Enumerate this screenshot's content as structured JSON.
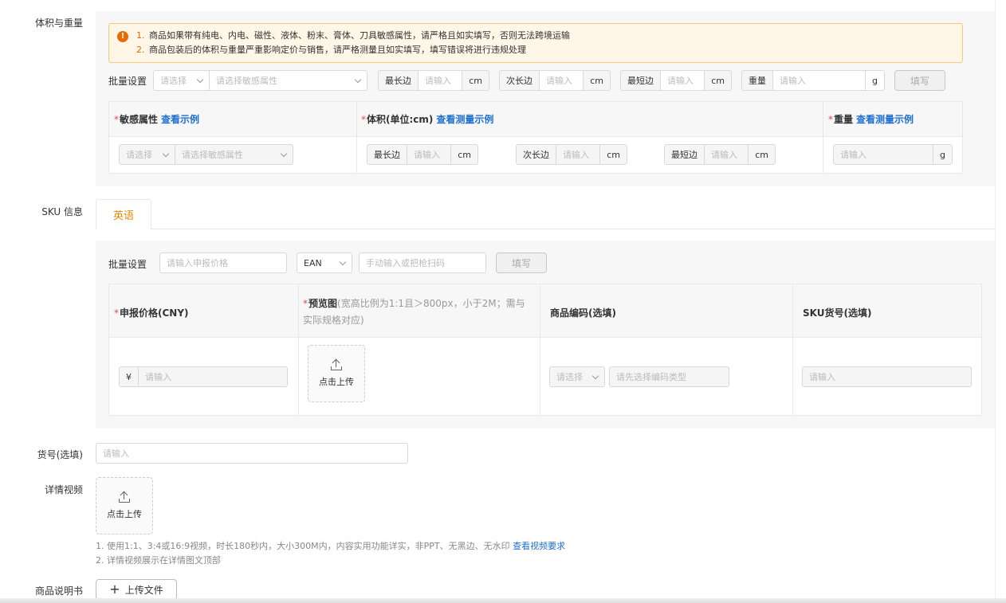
{
  "labels": {
    "volume_weight": "体积与重量",
    "sku_info": "SKU 信息",
    "item_no": "货号(选填)",
    "detail_video": "详情视频",
    "manual": "商品说明书"
  },
  "warning": {
    "line1_num": "1.",
    "line1": "商品如果带有纯电、内电、磁性、液体、粉末、膏体、刀具敏感属性，请严格且如实填写，否则无法跨境运输",
    "line2_num": "2.",
    "line2": "商品包装后的体积与重量严重影响定价与销售，请严格测量且如实填写，填写错误将进行违规处理"
  },
  "batch1": {
    "label": "批量设置",
    "select": "请选择",
    "sensitive": "请选择敏感属性",
    "longest": "最长边",
    "middle": "次长边",
    "shortest": "最短边",
    "weight": "重量",
    "placeholder": "请输入",
    "cm": "cm",
    "g": "g",
    "fill": "填写"
  },
  "vol_table": {
    "col1": "敏感属性",
    "col1_link": "查看示例",
    "col2": "体积(单位:cm)",
    "col2_link": "查看测量示例",
    "col3": "重量",
    "col3_link": "查看测量示例",
    "req": "*"
  },
  "tab": {
    "label": "英语"
  },
  "batch2": {
    "label": "批量设置",
    "price_ph": "请输入申报价格",
    "code_type": "EAN",
    "code_ph": "手动输入或把枪扫码",
    "fill": "填写"
  },
  "sku_table": {
    "col1": "申报价格(CNY)",
    "col2": "预览图",
    "col2_note": "(宽高比例为1:1且＞800px，小于2M；需与实际规格对应)",
    "col3": "商品编码(选填)",
    "col4": "SKU货号(选填)",
    "currency": "¥",
    "price_ph": "请输入",
    "upload": "点击上传",
    "code_select": "请选择",
    "code_ph": "请先选择编码类型",
    "sku_ph": "请输入",
    "req": "*"
  },
  "item_no": {
    "placeholder": "请输入"
  },
  "video": {
    "upload": "点击上传",
    "hint1": "1. 使用1:1、3:4或16:9视频，时长180秒内，大小300M内，内容实用功能详实，非PPT、无黑边、无水印",
    "hint1_link": "查看视频要求",
    "hint2": "2. 详情视频展示在详情图文顶部"
  },
  "manual": {
    "button": "上传文件"
  },
  "colors": {
    "accent": "#e58a00",
    "link": "#1f6fd1",
    "required": "#e5484d"
  }
}
